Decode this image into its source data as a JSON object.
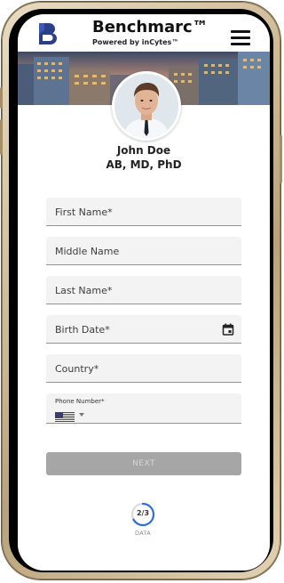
{
  "header": {
    "brand_title": "Benchmarc™",
    "brand_subtitle": "Powered by inCytes™",
    "logo_icon": "benchmarc-b-logo",
    "menu_icon": "hamburger-menu-icon"
  },
  "profile": {
    "name": "John Doe",
    "credentials": "AB, MD, PhD"
  },
  "form": {
    "fields": [
      {
        "label": "First Name*",
        "value": ""
      },
      {
        "label": "Middle Name",
        "value": ""
      },
      {
        "label": "Last Name*",
        "value": ""
      },
      {
        "label": "Birth Date*",
        "value": "",
        "icon": "calendar-icon"
      },
      {
        "label": "Country*",
        "value": ""
      }
    ],
    "phone": {
      "label": "Phone Number*",
      "country_flag": "us-flag-icon",
      "value": ""
    },
    "next_label": "NEXT"
  },
  "progress": {
    "step_text": "2/3",
    "current": 2,
    "total": 3,
    "label": "DATA"
  },
  "colors": {
    "logo_blue": "#2b3f86",
    "field_bg": "#f3f3f4",
    "field_border": "#8a94a2",
    "button_disabled": "#a6a6a6",
    "progress_blue": "#2f6fd6",
    "phone_frame_gold": "#c9b48f"
  }
}
